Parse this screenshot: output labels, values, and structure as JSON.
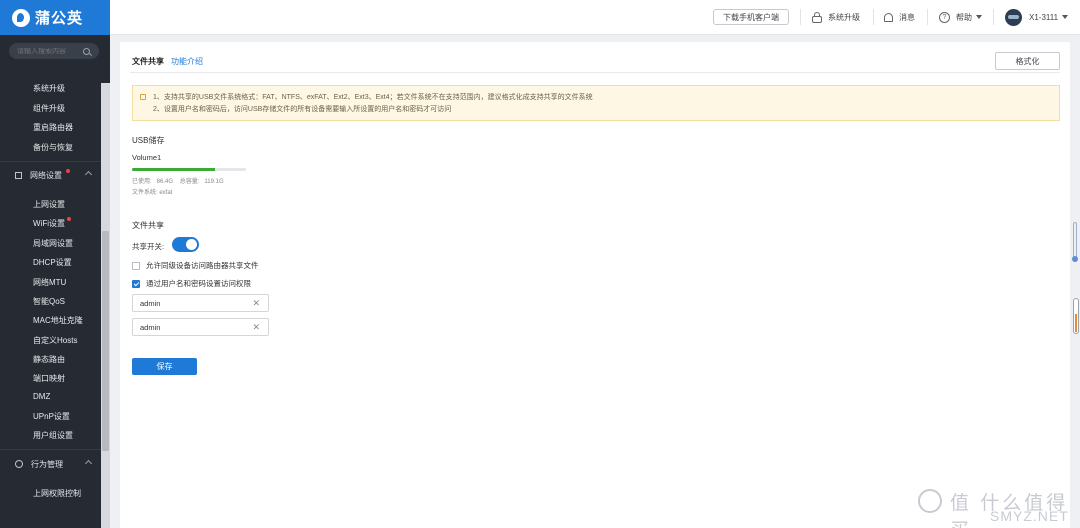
{
  "header": {
    "logo_text": "蒲公英",
    "download_label": "下载手机客户端",
    "upgrade_label": "系统升级",
    "messages_label": "消息",
    "help_label": "帮助",
    "device_label": "X1-3111"
  },
  "sidebar": {
    "search_placeholder": "请输入搜索内容",
    "system_items": [
      "系统升级",
      "组件升级",
      "重启路由器",
      "备份与恢复"
    ],
    "network_group": "网络设置",
    "network_items": [
      "上网设置",
      "WiFi设置",
      "局域网设置",
      "DHCP设置",
      "网络MTU",
      "智能QoS",
      "MAC地址克隆",
      "自定义Hosts",
      "静态路由",
      "端口映射",
      "DMZ",
      "UPnP设置",
      "用户组设置"
    ],
    "behavior_group": "行为管理",
    "behavior_items": [
      "上网权限控制"
    ]
  },
  "main": {
    "title": "文件共享",
    "intro_link": "功能介绍",
    "format_button": "格式化",
    "notice": [
      "1、支持共享的USB文件系统格式：FAT、NTFS、exFAT、Ext2、Ext3、Ext4；若文件系统不在支持范围内，建议格式化成支持共享的文件系统",
      "2、设置用户名和密码后，访问USB存储文件的所有设备需要输入所设置的用户名和密码才可访问"
    ],
    "usb_title": "USB储存",
    "volume": {
      "name": "Volume1",
      "used_label": "已使用:",
      "used": "86.4G",
      "total_label": "总容量:",
      "total": "119.1G",
      "fs_label": "文件系统:",
      "fs": "exfat",
      "used_fraction": 0.725
    },
    "share_title": "文件共享",
    "share_switch_label": "共享开关:",
    "share_switch_on": true,
    "allow_lan_label": "允许同级设备访问路由器共享文件",
    "allow_lan_checked": false,
    "auth_label": "通过用户名和密码设置访问权限",
    "auth_checked": true,
    "username_value": "admin",
    "password_value": "admin",
    "save_button": "保存"
  },
  "watermark": {
    "text": "值 什么值得买",
    "sub": "SMYZ.NET"
  },
  "colors": {
    "brand": "#1f79d7",
    "sidebar_bg": "#262b33",
    "progress": "#3aaa35"
  }
}
